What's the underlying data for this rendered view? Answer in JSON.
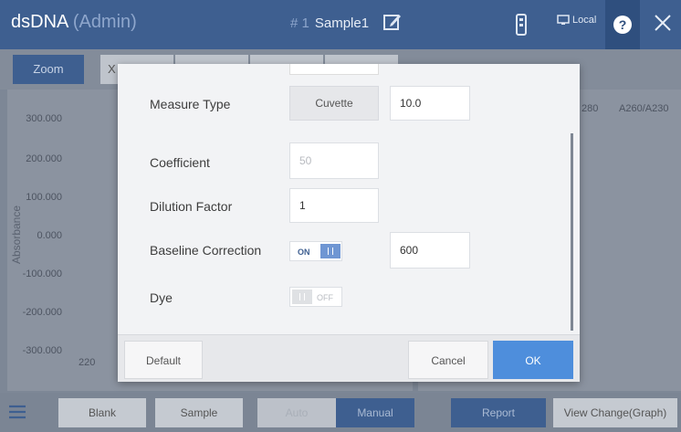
{
  "header": {
    "app_name": "dsDNA",
    "role": "(Admin)",
    "sample_number": "# 1",
    "sample_name": "Sample1",
    "connection": "Local",
    "icons": [
      "edit-icon",
      "usb-icon",
      "monitor-icon",
      "help-icon",
      "close-icon"
    ]
  },
  "toolbar": {
    "zoom_label": "Zoom",
    "partial_label": "X"
  },
  "graph": {
    "y_axis_label": "Absorbance",
    "y_ticks": [
      "300.000",
      "200.000",
      "100.000",
      "0.000",
      "-100.000",
      "-200.000",
      "-300.000"
    ],
    "x_ticks": [
      "220"
    ]
  },
  "table": {
    "columns": [
      "280",
      "A260/A230"
    ]
  },
  "dialog": {
    "measure_type_label": "Measure Type",
    "measure_type_button": "Cuvette",
    "measure_type_value": "10.0",
    "coefficient_label": "Coefficient",
    "coefficient_value": "50",
    "dilution_label": "Dilution Factor",
    "dilution_value": "1",
    "baseline_label": "Baseline Correction",
    "baseline_toggle": "ON",
    "baseline_on": true,
    "baseline_value": "600",
    "dye_label": "Dye",
    "dye_toggle": "OFF",
    "dye_on": false,
    "default_label": "Default",
    "cancel_label": "Cancel",
    "ok_label": "OK"
  },
  "bottom_bar": {
    "blank_label": "Blank",
    "sample_label": "Sample",
    "auto_label": "Auto",
    "manual_label": "Manual",
    "report_label": "Report",
    "view_change_label": "View Change(Graph)"
  },
  "colors": {
    "primary": "#3e5f90",
    "accent": "#4e8edc",
    "toggle_on": "#6f96d3"
  }
}
